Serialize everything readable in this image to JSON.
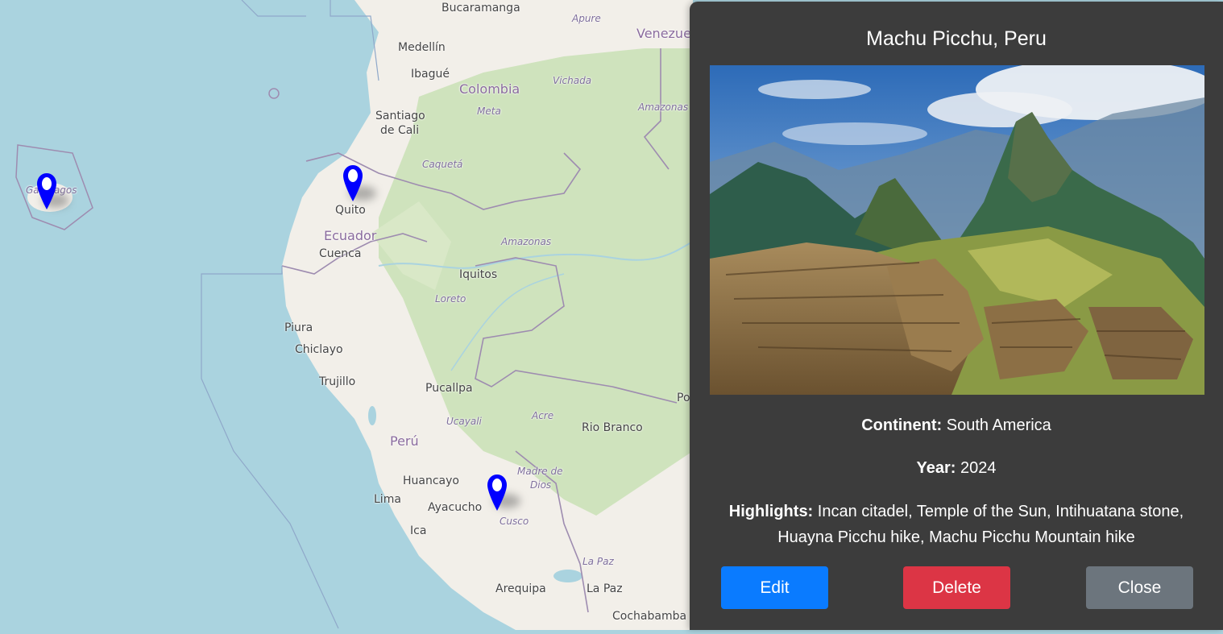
{
  "map": {
    "labels": {
      "bucaramanga": "Bucaramanga",
      "apure": "Apure",
      "venezuela": "Venezue",
      "medellin": "Medellín",
      "ibague": "Ibagué",
      "colombia": "Colombia",
      "vichada": "Vichada",
      "meta": "Meta",
      "amazonas_co": "Amazonas",
      "santiago": "Santiago",
      "de_cali": "de Cali",
      "caqueta": "Caquetá",
      "galapagos": "Galápagos",
      "quito": "Quito",
      "ecuador": "Ecuador",
      "cuenca": "Cuenca",
      "amazonas_pe": "Amazonas",
      "iquitos": "Iquitos",
      "loreto": "Loreto",
      "piura": "Piura",
      "chiclayo": "Chiclayo",
      "trujillo": "Trujillo",
      "pucallpa": "Pucallpa",
      "ucayali": "Ucayali",
      "acre": "Acre",
      "rio_branco": "Rio Branco",
      "peru": "Perú",
      "madre_de": "Madre de",
      "dios": "Dios",
      "huancayo": "Huancayo",
      "lima": "Lima",
      "ayacucho": "Ayacucho",
      "cusco": "Cusco",
      "ica": "Ica",
      "la_paz": "La Paz",
      "arequipa": "Arequipa",
      "la_paz_city": "La Paz",
      "cochabamba": "Cochabamba",
      "po": "Po"
    },
    "markers": [
      {
        "name": "Galápagos",
        "color": "#0000ff"
      },
      {
        "name": "Quito",
        "color": "#0000ff"
      },
      {
        "name": "Machu Picchu",
        "color": "#0000ff"
      }
    ],
    "colors": {
      "ocean": "#aad3df",
      "land": "#f2efe9",
      "forest": "#cfe3bd",
      "border": "#9e8cb0"
    }
  },
  "panel": {
    "title": "Machu Picchu, Peru",
    "continent_label": "Continent:",
    "continent": "South America",
    "year_label": "Year:",
    "year": "2024",
    "highlights_label": "Highlights:",
    "highlights": "Incan citadel, Temple of the Sun, Intihuatana stone, Huayna Picchu hike, Machu Picchu Mountain hike",
    "buttons": {
      "edit": "Edit",
      "delete": "Delete",
      "close": "Close"
    },
    "colors": {
      "background": "#3c3c3c",
      "edit": "#0a7bff",
      "delete": "#dc3545",
      "close": "#6c757d"
    }
  }
}
